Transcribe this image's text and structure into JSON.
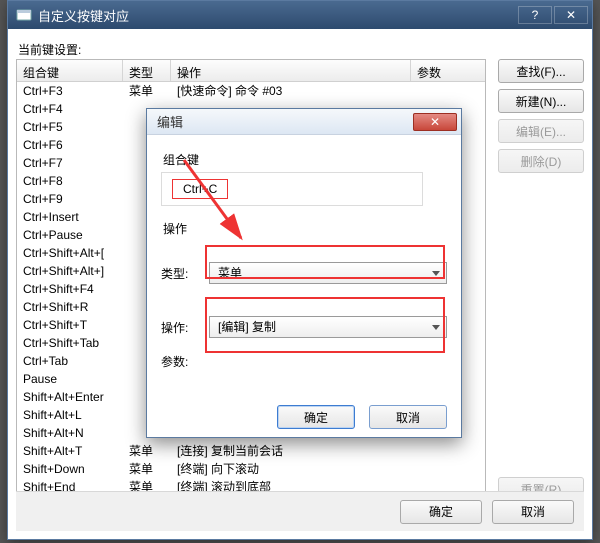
{
  "main": {
    "title": "自定义按键对应",
    "current_settings_label": "当前键设置:",
    "columns": {
      "c1": "组合键",
      "c2": "类型",
      "c3": "操作",
      "c4": "参数"
    },
    "rows": [
      {
        "key": "Ctrl+F3",
        "type": "菜单",
        "op": "[快速命令] 命令 #03",
        "param": ""
      },
      {
        "key": "Ctrl+F4",
        "type": "",
        "op": "",
        "param": ""
      },
      {
        "key": "Ctrl+F5",
        "type": "",
        "op": "",
        "param": ""
      },
      {
        "key": "Ctrl+F6",
        "type": "",
        "op": "",
        "param": ""
      },
      {
        "key": "Ctrl+F7",
        "type": "",
        "op": "",
        "param": ""
      },
      {
        "key": "Ctrl+F8",
        "type": "",
        "op": "",
        "param": ""
      },
      {
        "key": "Ctrl+F9",
        "type": "",
        "op": "",
        "param": ""
      },
      {
        "key": "Ctrl+Insert",
        "type": "",
        "op": "",
        "param": ""
      },
      {
        "key": "Ctrl+Pause",
        "type": "",
        "op": "",
        "param": ""
      },
      {
        "key": "Ctrl+Shift+Alt+[",
        "type": "",
        "op": "",
        "param": ""
      },
      {
        "key": "Ctrl+Shift+Alt+]",
        "type": "",
        "op": "",
        "param": ""
      },
      {
        "key": "Ctrl+Shift+F4",
        "type": "",
        "op": "",
        "param": ""
      },
      {
        "key": "Ctrl+Shift+R",
        "type": "",
        "op": "",
        "param": ""
      },
      {
        "key": "Ctrl+Shift+T",
        "type": "",
        "op": "",
        "param": ""
      },
      {
        "key": "Ctrl+Shift+Tab",
        "type": "",
        "op": "",
        "param": ""
      },
      {
        "key": "Ctrl+Tab",
        "type": "",
        "op": "",
        "param": ""
      },
      {
        "key": "Pause",
        "type": "",
        "op": "",
        "param": ""
      },
      {
        "key": "Shift+Alt+Enter",
        "type": "",
        "op": "",
        "param": ""
      },
      {
        "key": "Shift+Alt+L",
        "type": "",
        "op": "",
        "param": ""
      },
      {
        "key": "Shift+Alt+N",
        "type": "",
        "op": "",
        "param": ""
      },
      {
        "key": "Shift+Alt+T",
        "type": "菜单",
        "op": "[连接] 复制当前会话",
        "param": ""
      },
      {
        "key": "Shift+Down",
        "type": "菜单",
        "op": "[终端] 向下滚动",
        "param": ""
      },
      {
        "key": "Shift+End",
        "type": "菜单",
        "op": "[终端] 滚动到底部",
        "param": ""
      }
    ],
    "side": {
      "find": "查找(F)...",
      "new": "新建(N)...",
      "edit": "编辑(E)...",
      "delete": "删除(D)",
      "reset": "重置(R)"
    },
    "ok": "确定",
    "cancel": "取消"
  },
  "dialog": {
    "title": "编辑",
    "group_key": "组合键",
    "key_value": "Ctrl+C",
    "group_op": "操作",
    "type_label": "类型:",
    "type_value": "菜单",
    "op_label": "操作:",
    "op_value": "[编辑] 复制",
    "param_label": "参数:",
    "ok": "确定",
    "cancel": "取消"
  }
}
